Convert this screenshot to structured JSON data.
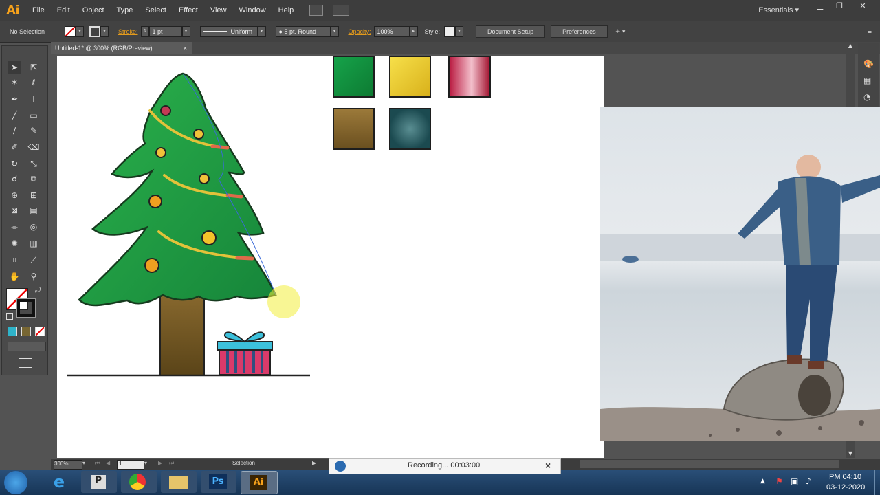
{
  "app": {
    "logo": "Ai",
    "menu": [
      "File",
      "Edit",
      "Object",
      "Type",
      "Select",
      "Effect",
      "View",
      "Window",
      "Help"
    ],
    "workspace": "Essentials"
  },
  "control_bar": {
    "selection": "No Selection",
    "stroke_label": "Stroke:",
    "stroke_weight": "1 pt",
    "stroke_profile": "Uniform",
    "brush": "5 pt. Round",
    "opacity_label": "Opacity:",
    "opacity": "100%",
    "style_label": "Style:",
    "document_setup": "Document Setup",
    "preferences": "Preferences"
  },
  "document_tab": {
    "title": "Untitled-1* @ 300% (RGB/Preview)",
    "close": "×"
  },
  "status": {
    "zoom": "300%",
    "artboard": "1",
    "tool": "Selection"
  },
  "recording": {
    "text": "Recording... 00:03:00",
    "close": "×"
  },
  "taskbar": {
    "time": "PM 04:10",
    "date": "03-12-2020"
  },
  "swatches": {
    "colors": [
      "#22a34a",
      "#f2cf33",
      "#c3173f",
      "#8a6a2f",
      "#2a5a5e"
    ]
  },
  "icons": {
    "palette": [
      "selection-icon",
      "direct-selection-icon",
      "magic-wand-icon",
      "lasso-icon",
      "pen-icon",
      "type-icon",
      "line-icon",
      "rectangle-icon",
      "paintbrush-icon",
      "pencil-icon",
      "blob-brush-icon",
      "eraser-icon",
      "rotate-icon",
      "scale-icon",
      "warp-icon",
      "free-transform-icon",
      "shape-builder-icon",
      "perspective-grid-icon",
      "mesh-icon",
      "gradient-icon",
      "eyedropper-icon",
      "blend-icon",
      "symbol-sprayer-icon",
      "column-graph-icon",
      "artboard-icon",
      "slice-icon",
      "hand-icon",
      "zoom-icon"
    ]
  }
}
